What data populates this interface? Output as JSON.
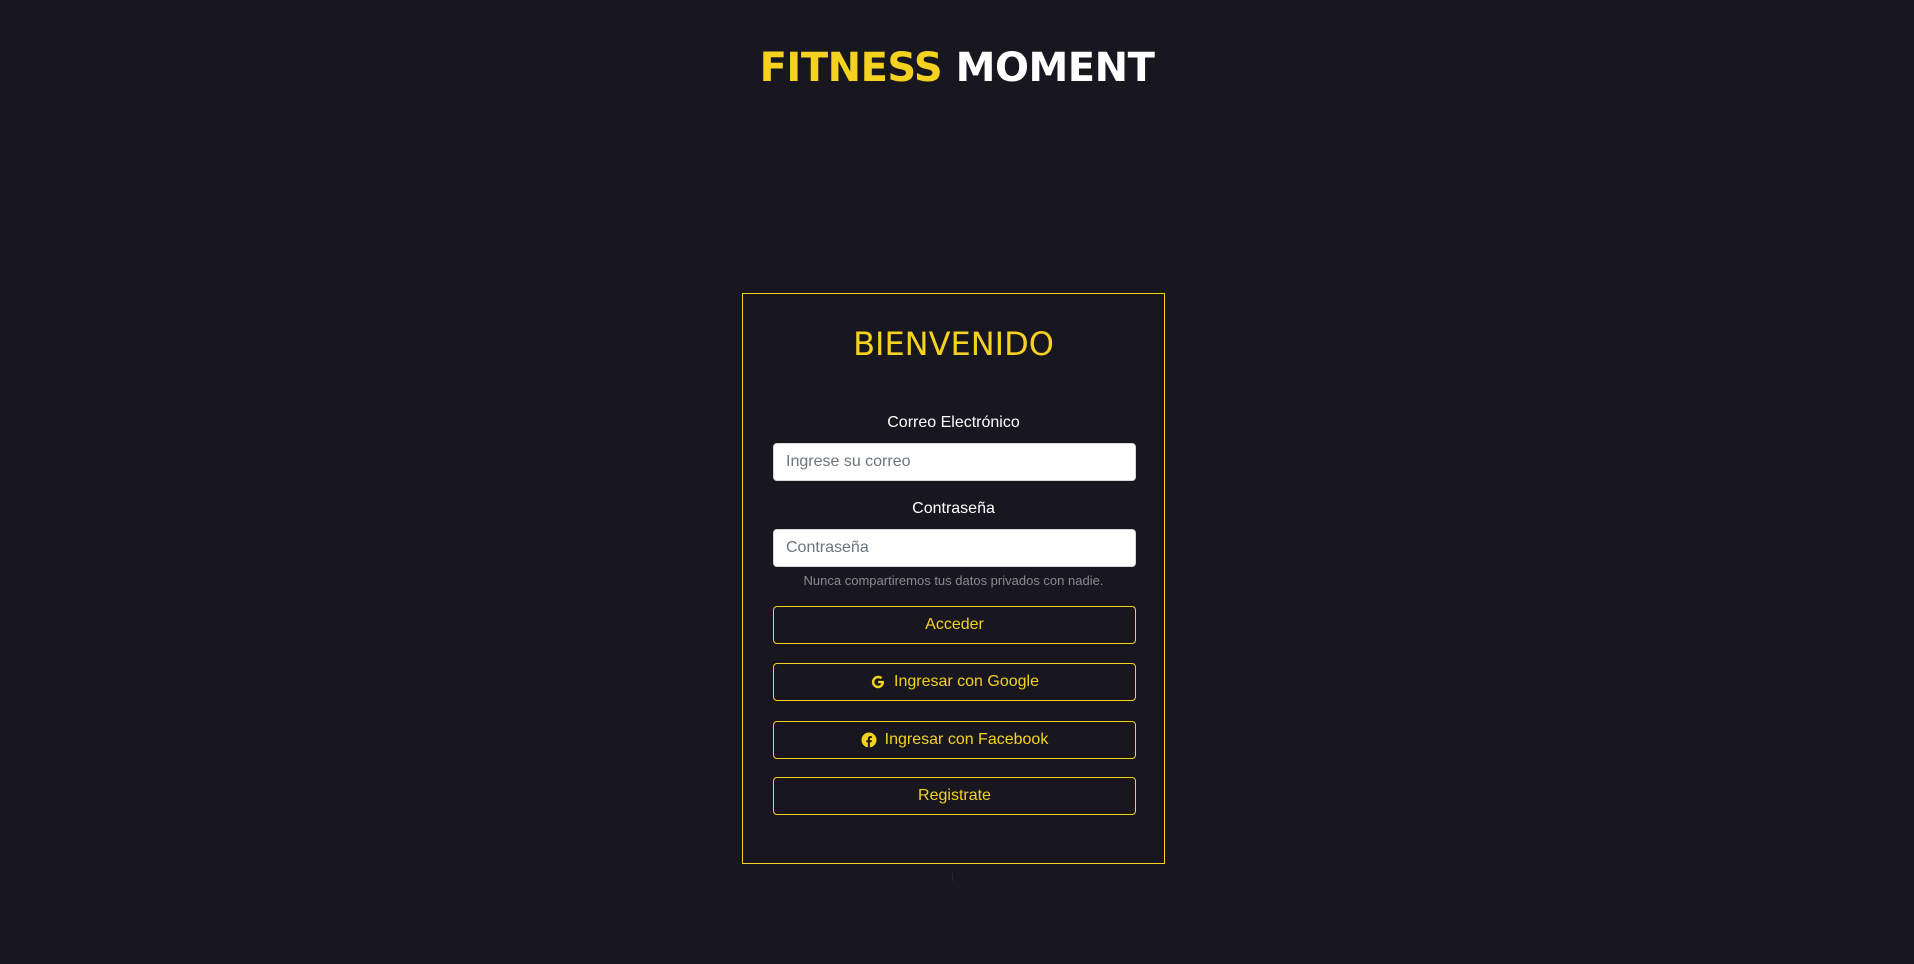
{
  "header": {
    "brand_part1": "FITNESS",
    "brand_part2": "MOMENT"
  },
  "login": {
    "title": "BIENVENIDO",
    "email_label": "Correo Electrónico",
    "email_placeholder": "Ingrese su correo",
    "email_value": "",
    "password_label": "Contraseña",
    "password_placeholder": "Contraseña",
    "password_value": "",
    "privacy_note": "Nunca compartiremos tus datos privados con nadie.",
    "submit_label": "Acceder",
    "google_label": "Ingresar con Google",
    "facebook_label": "Ingresar con Facebook",
    "register_label": "Registrate"
  },
  "icons": {
    "google": "google-icon",
    "facebook": "facebook-icon"
  },
  "colors": {
    "background": "#18171f",
    "accent": "#f5d21f",
    "text": "#ffffff",
    "muted": "#8a8a90"
  }
}
